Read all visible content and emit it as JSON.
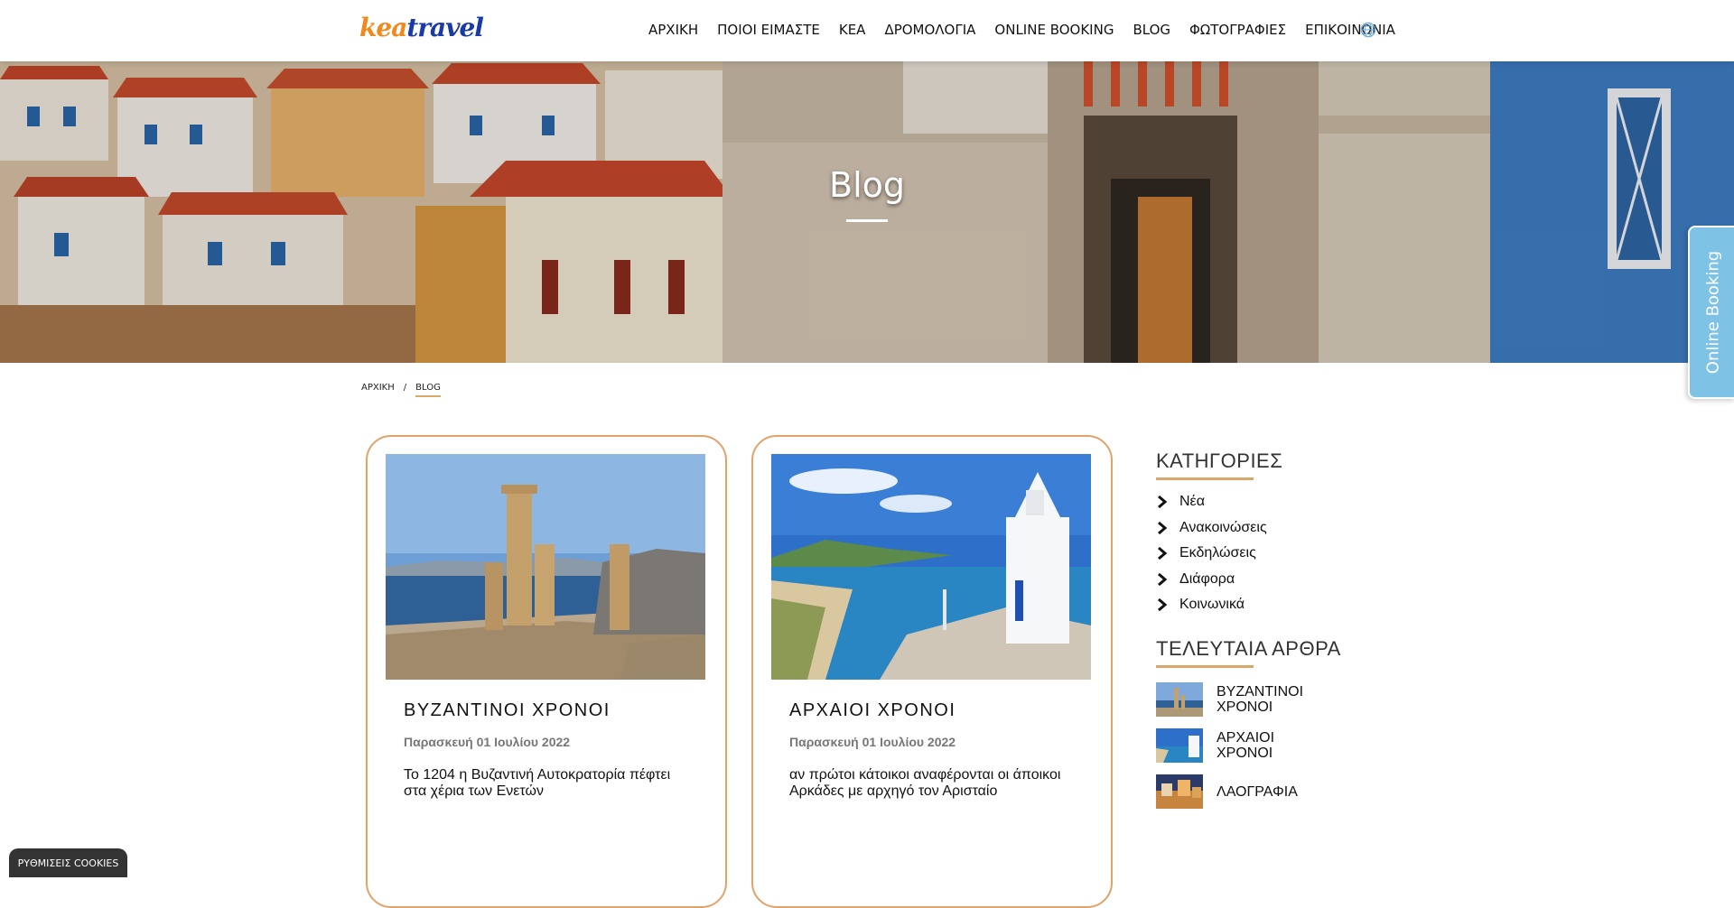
{
  "logo": {
    "part1": "kea",
    "part2": "travel"
  },
  "nav": [
    {
      "label": "ΑΡΧΙΚΗ"
    },
    {
      "label": "ΠΟΙΟΙ ΕΙΜΑΣΤΕ"
    },
    {
      "label": "ΚΕΑ"
    },
    {
      "label": "ΔΡΟΜΟΛΟΓΙΑ"
    },
    {
      "label": "ONLINE BOOKING"
    },
    {
      "label": "BLOG"
    },
    {
      "label": "ΦΩΤΟΓΡΑΦΙΕΣ"
    },
    {
      "label": "ΕΠΙΚΟΙΝΩΝΙΑ"
    }
  ],
  "hero": {
    "title": "Blog"
  },
  "side_tab": {
    "label": "Online Booking"
  },
  "breadcrumb": {
    "home": "ΑΡΧΙΚΗ",
    "sep": "/",
    "current": "BLOG"
  },
  "cards": [
    {
      "title": "ΒΥΖΑΝΤΙΝΟΙ ΧΡΟΝΟΙ",
      "date": "Παρασκευή 01 Ιουλίου 2022",
      "excerpt": "Το 1204 η Βυζαντινή Αυτοκρατορία πέφτει στα χέρια των Ενετών"
    },
    {
      "title": "ΑΡΧΑΙΟΙ ΧΡΟΝΟΙ",
      "date": "Παρασκευή 01 Ιουλίου 2022",
      "excerpt": "αν πρώτοι κάτοικοι αναφέρονται οι άποικοι Αρκάδες με αρχηγό τον Αρισταίο"
    }
  ],
  "sidebar": {
    "categories_title": "ΚΑΤΗΓΟΡΙΕΣ",
    "categories": [
      "Νέα",
      "Ανακοινώσεις",
      "Εκδηλώσεις",
      "Διάφορα",
      "Κοινωνικά"
    ],
    "recent_title": "ΤΕΛΕΥΤΑΙΑ ΑΡΘΡΑ",
    "recent": [
      "ΒΥΖΑΝΤΙΝΟΙ ΧΡΟΝΟΙ",
      "ΑΡΧΑΙΟΙ ΧΡΟΝΟΙ",
      "ΛΑΟΓΡΑΦΙΑ"
    ]
  },
  "cookie": {
    "label": "ΡΥΘΜΙΣΕΙΣ COOKIES"
  },
  "colors": {
    "accent": "#d9a76a",
    "card_border": "#e0a46a",
    "side_tab": "#7ec2e6",
    "logo_orange": "#f08a1c",
    "logo_blue": "#1a3aa8"
  }
}
